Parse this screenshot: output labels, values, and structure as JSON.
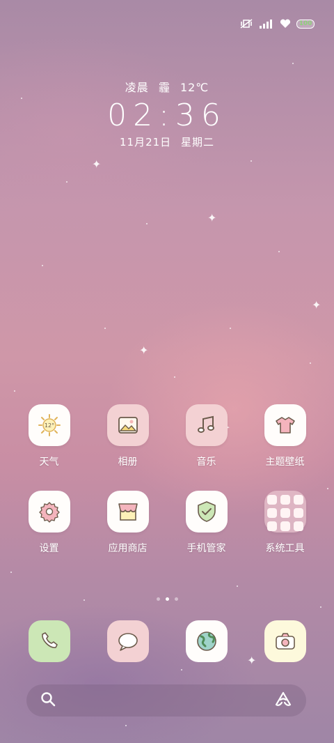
{
  "status_bar": {
    "icons": [
      "mute-vibrate-icon",
      "signal-icon",
      "heart-icon",
      "battery-icon"
    ],
    "battery_level": "100",
    "battery_color": "#8fd27a"
  },
  "clock_widget": {
    "period": "凌晨",
    "weather": "霾",
    "temperature": "12℃",
    "time": "02:36",
    "date": "11月21日",
    "weekday": "星期二"
  },
  "apps": [
    {
      "label": "天气",
      "icon": "weather-sun-icon",
      "badge": "12°"
    },
    {
      "label": "相册",
      "icon": "gallery-icon"
    },
    {
      "label": "音乐",
      "icon": "music-note-icon"
    },
    {
      "label": "主题壁纸",
      "icon": "tshirt-icon"
    },
    {
      "label": "设置",
      "icon": "gear-icon"
    },
    {
      "label": "应用商店",
      "icon": "store-icon"
    },
    {
      "label": "手机管家",
      "icon": "shield-check-icon"
    },
    {
      "label": "系统工具",
      "icon": "folder-icon"
    }
  ],
  "pager": {
    "pages": 3,
    "current": 2
  },
  "dock": [
    {
      "icon": "phone-icon"
    },
    {
      "icon": "message-icon"
    },
    {
      "icon": "browser-globe-icon"
    },
    {
      "icon": "camera-icon"
    }
  ],
  "search_bar": {
    "left_icon": "search-icon",
    "right_icon": "assistant-icon"
  },
  "colors": {
    "accent_pink": "#f3d1d3",
    "tile_white": "#fffdfb",
    "phone_green": "#cce7b6",
    "camera_cream": "#fdf9dc"
  }
}
